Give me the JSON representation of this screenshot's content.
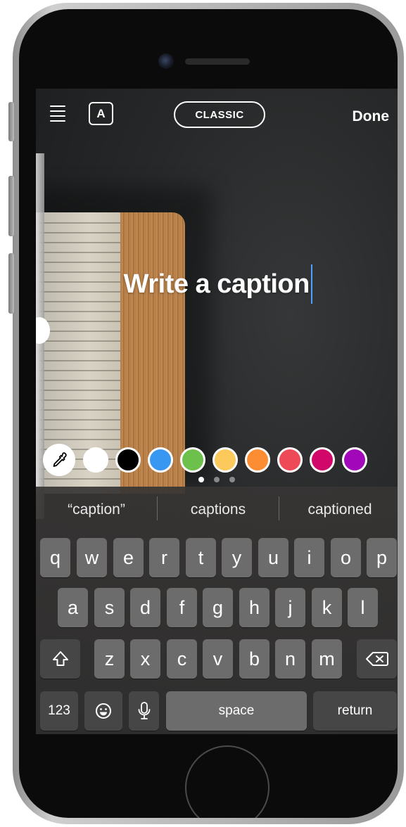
{
  "topbar": {
    "style_label": "CLASSIC",
    "bg_toggle_label": "A",
    "done_label": "Done"
  },
  "caption": {
    "text": "Write a caption"
  },
  "colors": {
    "accent_cursor": "#4aa3ff",
    "swatches": [
      {
        "name": "white",
        "hex": "#ffffff"
      },
      {
        "name": "black",
        "hex": "#000000"
      },
      {
        "name": "blue",
        "hex": "#3897f0"
      },
      {
        "name": "green",
        "hex": "#6dc04b"
      },
      {
        "name": "yellow",
        "hex": "#fcc95c"
      },
      {
        "name": "orange",
        "hex": "#fd8d32"
      },
      {
        "name": "red",
        "hex": "#ed4956"
      },
      {
        "name": "magenta",
        "hex": "#d10869"
      },
      {
        "name": "purple",
        "hex": "#a307ba"
      }
    ],
    "page_dots": {
      "total": 3,
      "active": 1
    }
  },
  "keyboard": {
    "suggestions": [
      "“caption”",
      "captions",
      "captioned"
    ],
    "row1": [
      "q",
      "w",
      "e",
      "r",
      "t",
      "y",
      "u",
      "i",
      "o",
      "p"
    ],
    "row2": [
      "a",
      "s",
      "d",
      "f",
      "g",
      "h",
      "j",
      "k",
      "l"
    ],
    "row3": [
      "z",
      "x",
      "c",
      "v",
      "b",
      "n",
      "m"
    ],
    "numbers_label": "123",
    "space_label": "space",
    "return_label": "return",
    "icons": {
      "shift": "shift-icon",
      "delete": "backspace-icon",
      "emoji": "emoji-icon",
      "mic": "microphone-icon"
    }
  }
}
